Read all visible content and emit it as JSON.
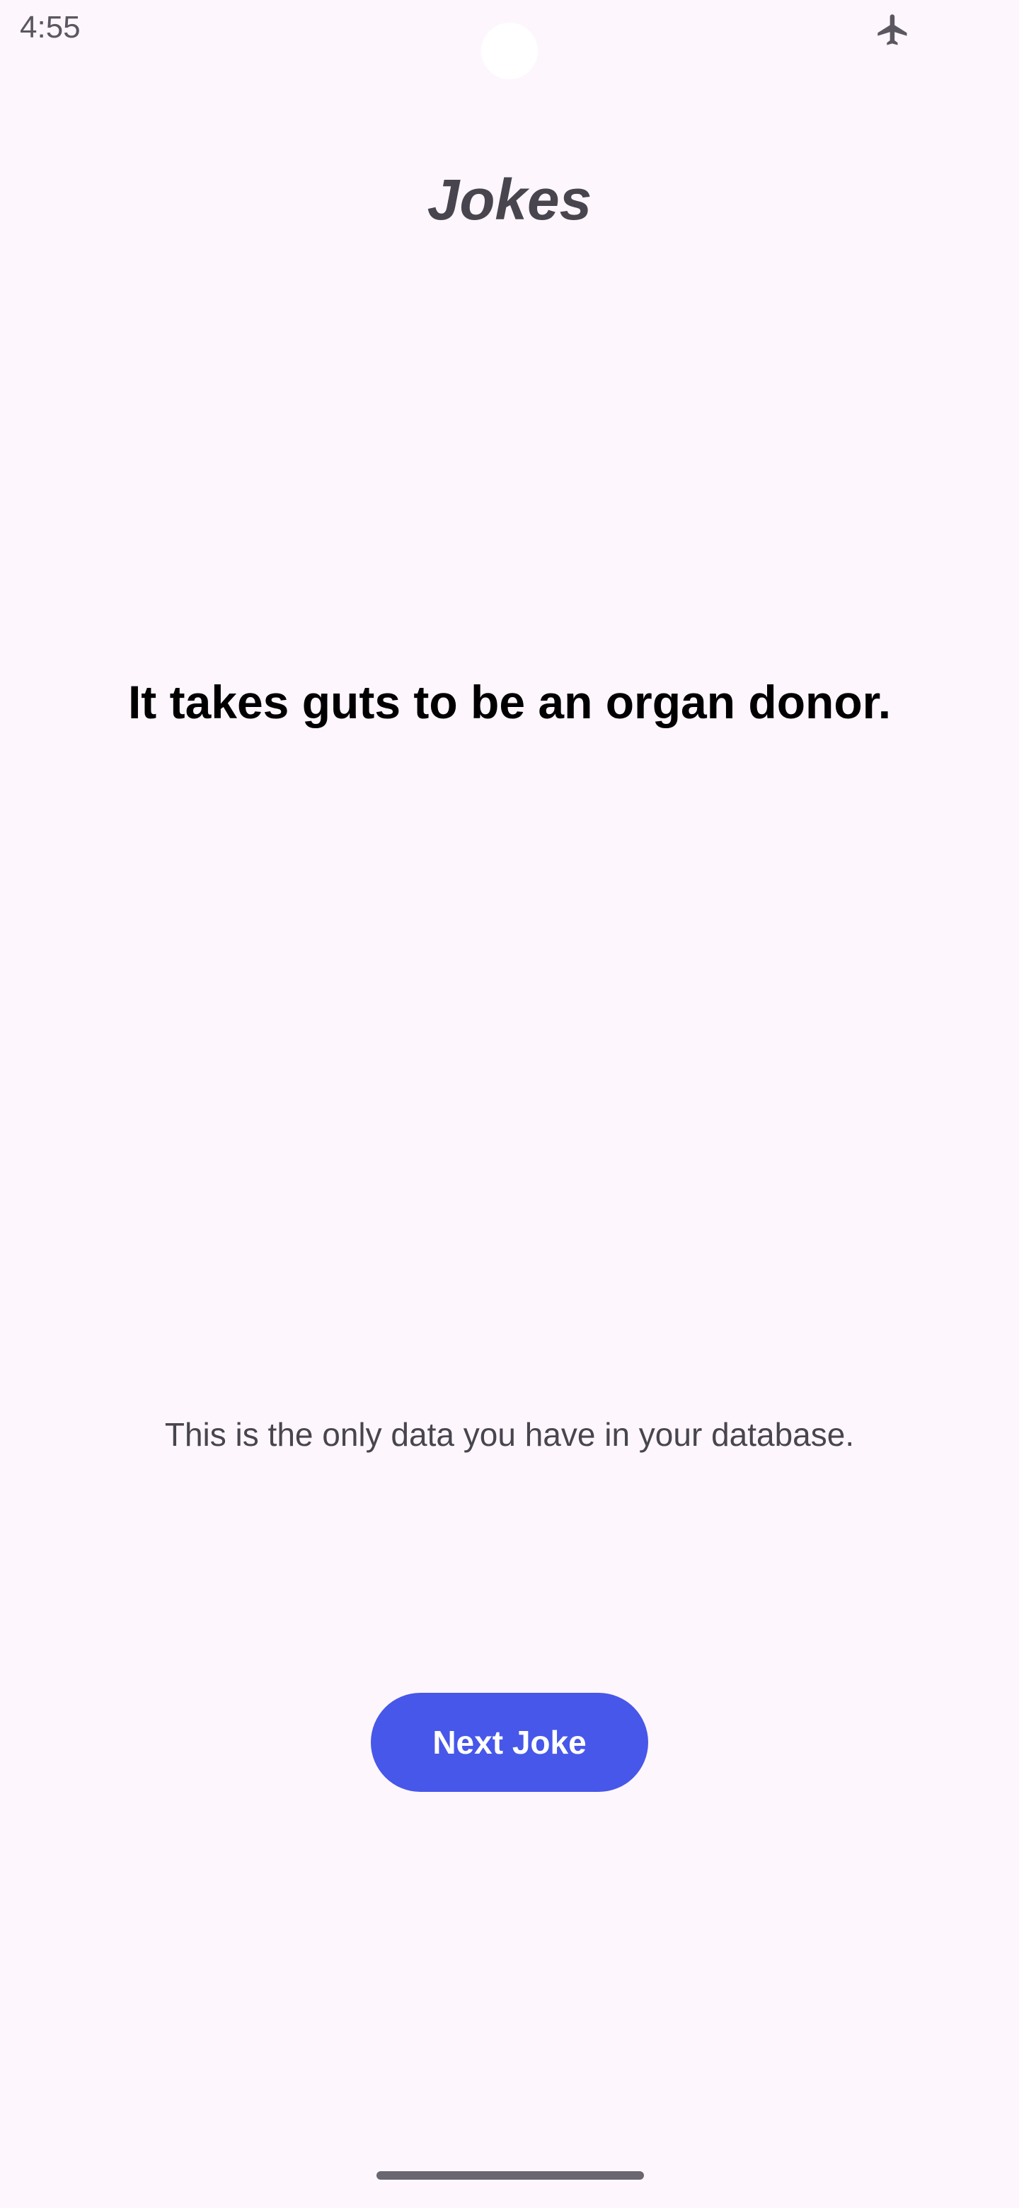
{
  "status_bar": {
    "time": "4:55",
    "icons": [
      "airplane-mode-icon"
    ]
  },
  "app": {
    "title": "Jokes"
  },
  "joke": {
    "text": "It takes guts to be an organ donor."
  },
  "info": {
    "message": "This is the only data you have in your database."
  },
  "actions": {
    "next_label": "Next Joke"
  },
  "colors": {
    "background": "#fdf6fd",
    "accent": "#4757e9",
    "title_text": "#48454e",
    "body_text": "#000000",
    "button_text": "#ffffff"
  }
}
